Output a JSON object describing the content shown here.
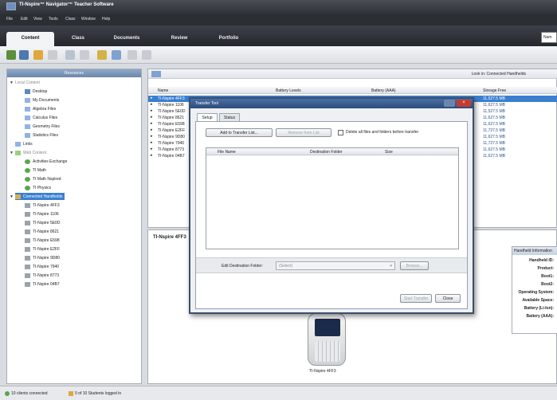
{
  "window": {
    "title": "TI-Nspire™ Navigator™ Teacher Software"
  },
  "menu": [
    "File",
    "Edit",
    "View",
    "Tools",
    "Class",
    "Window",
    "Help"
  ],
  "tabs": [
    "Content",
    "Class",
    "Documents",
    "Review",
    "Portfolio"
  ],
  "search": {
    "value": "Nam"
  },
  "left_panel": {
    "header": "Resources",
    "items": [
      {
        "label": "Local Content",
        "type": "group"
      },
      {
        "label": "Desktop",
        "type": "folder"
      },
      {
        "label": "My Documents",
        "type": "folder"
      },
      {
        "label": "Algebra Files",
        "type": "folder"
      },
      {
        "label": "Calculus Files",
        "type": "folder"
      },
      {
        "label": "Geometry Files",
        "type": "folder"
      },
      {
        "label": "Statistics Files",
        "type": "folder"
      },
      {
        "label": "Links",
        "type": "folder"
      },
      {
        "label": "Web Content",
        "type": "group"
      },
      {
        "label": "Activities Exchange",
        "type": "web"
      },
      {
        "label": "TI Math",
        "type": "web"
      },
      {
        "label": "TI Math Nspired",
        "type": "web"
      },
      {
        "label": "TI Physics",
        "type": "web"
      },
      {
        "label": "Connected Handhelds",
        "type": "group",
        "selected": true
      },
      {
        "label": "TI-Nspire 4FF3",
        "type": "device"
      },
      {
        "label": "TI-Nspire 1106",
        "type": "device"
      },
      {
        "label": "TI-Nspire 5E0D",
        "type": "device"
      },
      {
        "label": "TI-Nspire 8621",
        "type": "device"
      },
      {
        "label": "TI-Nspire E598",
        "type": "device"
      },
      {
        "label": "TI-Nspire E2FF",
        "type": "device"
      },
      {
        "label": "TI-Nspire 9D80",
        "type": "device"
      },
      {
        "label": "TI-Nspire 7940",
        "type": "device"
      },
      {
        "label": "TI-Nspire 8773",
        "type": "device"
      },
      {
        "label": "TI-Nspire 04B7",
        "type": "device"
      }
    ]
  },
  "center": {
    "lookin_label": "Look in: Connected Handhelds",
    "columns": [
      "Name",
      "Battery Levels",
      "Battery (AAA)",
      "Storage Free"
    ],
    "rows": [
      {
        "name": "TI-Nspire 4FF3",
        "storage": "11,527.5 MB",
        "selected": true
      },
      {
        "name": "TI-Nspire 1106",
        "storage": "11,627.5 MB"
      },
      {
        "name": "TI-Nspire 5E0D",
        "storage": "11,527.5 MB"
      },
      {
        "name": "TI-Nspire 8621",
        "storage": "11,627.5 MB"
      },
      {
        "name": "TI-Nspire E598",
        "storage": "11,627.5 MB"
      },
      {
        "name": "TI-Nspire E2FF",
        "storage": "11,727.5 MB"
      },
      {
        "name": "TI-Nspire 9D80",
        "storage": "11,627.5 MB"
      },
      {
        "name": "TI-Nspire 7940",
        "storage": "11,727.5 MB"
      },
      {
        "name": "TI-Nspire 8773",
        "storage": "11,627.5 MB"
      },
      {
        "name": "TI-Nspire 04B7",
        "storage": "11,627.5 MB"
      }
    ]
  },
  "detail": {
    "title": "TI-Nspire 4FF3",
    "device_label": "TI-Nspire 4FF3",
    "info_header": "Handheld Information",
    "info_labels": [
      "Handheld ID:",
      "Product:",
      "Boot1:",
      "Boot2:",
      "Operating System:",
      "Available Space:",
      "Battery (Li-Ion):",
      "Battery (AAA):"
    ]
  },
  "dialog": {
    "title": "Transfer Tool",
    "tabs": [
      "Setup",
      "Status"
    ],
    "add_button": "Add to Transfer List...",
    "remove_button": "Remove from List",
    "checkbox_label": "Delete all files and folders before transfer",
    "columns": [
      "File Name",
      "Destination Folder",
      "Size"
    ],
    "dest_label": "Edit Destination Folder:",
    "dest_value": "(Select)",
    "browse_button": "Browse...",
    "start_button": "Start Transfer",
    "close_button": "Close"
  },
  "status": {
    "left": "10 clients connected",
    "right": "0 of 10 Students logged in"
  }
}
